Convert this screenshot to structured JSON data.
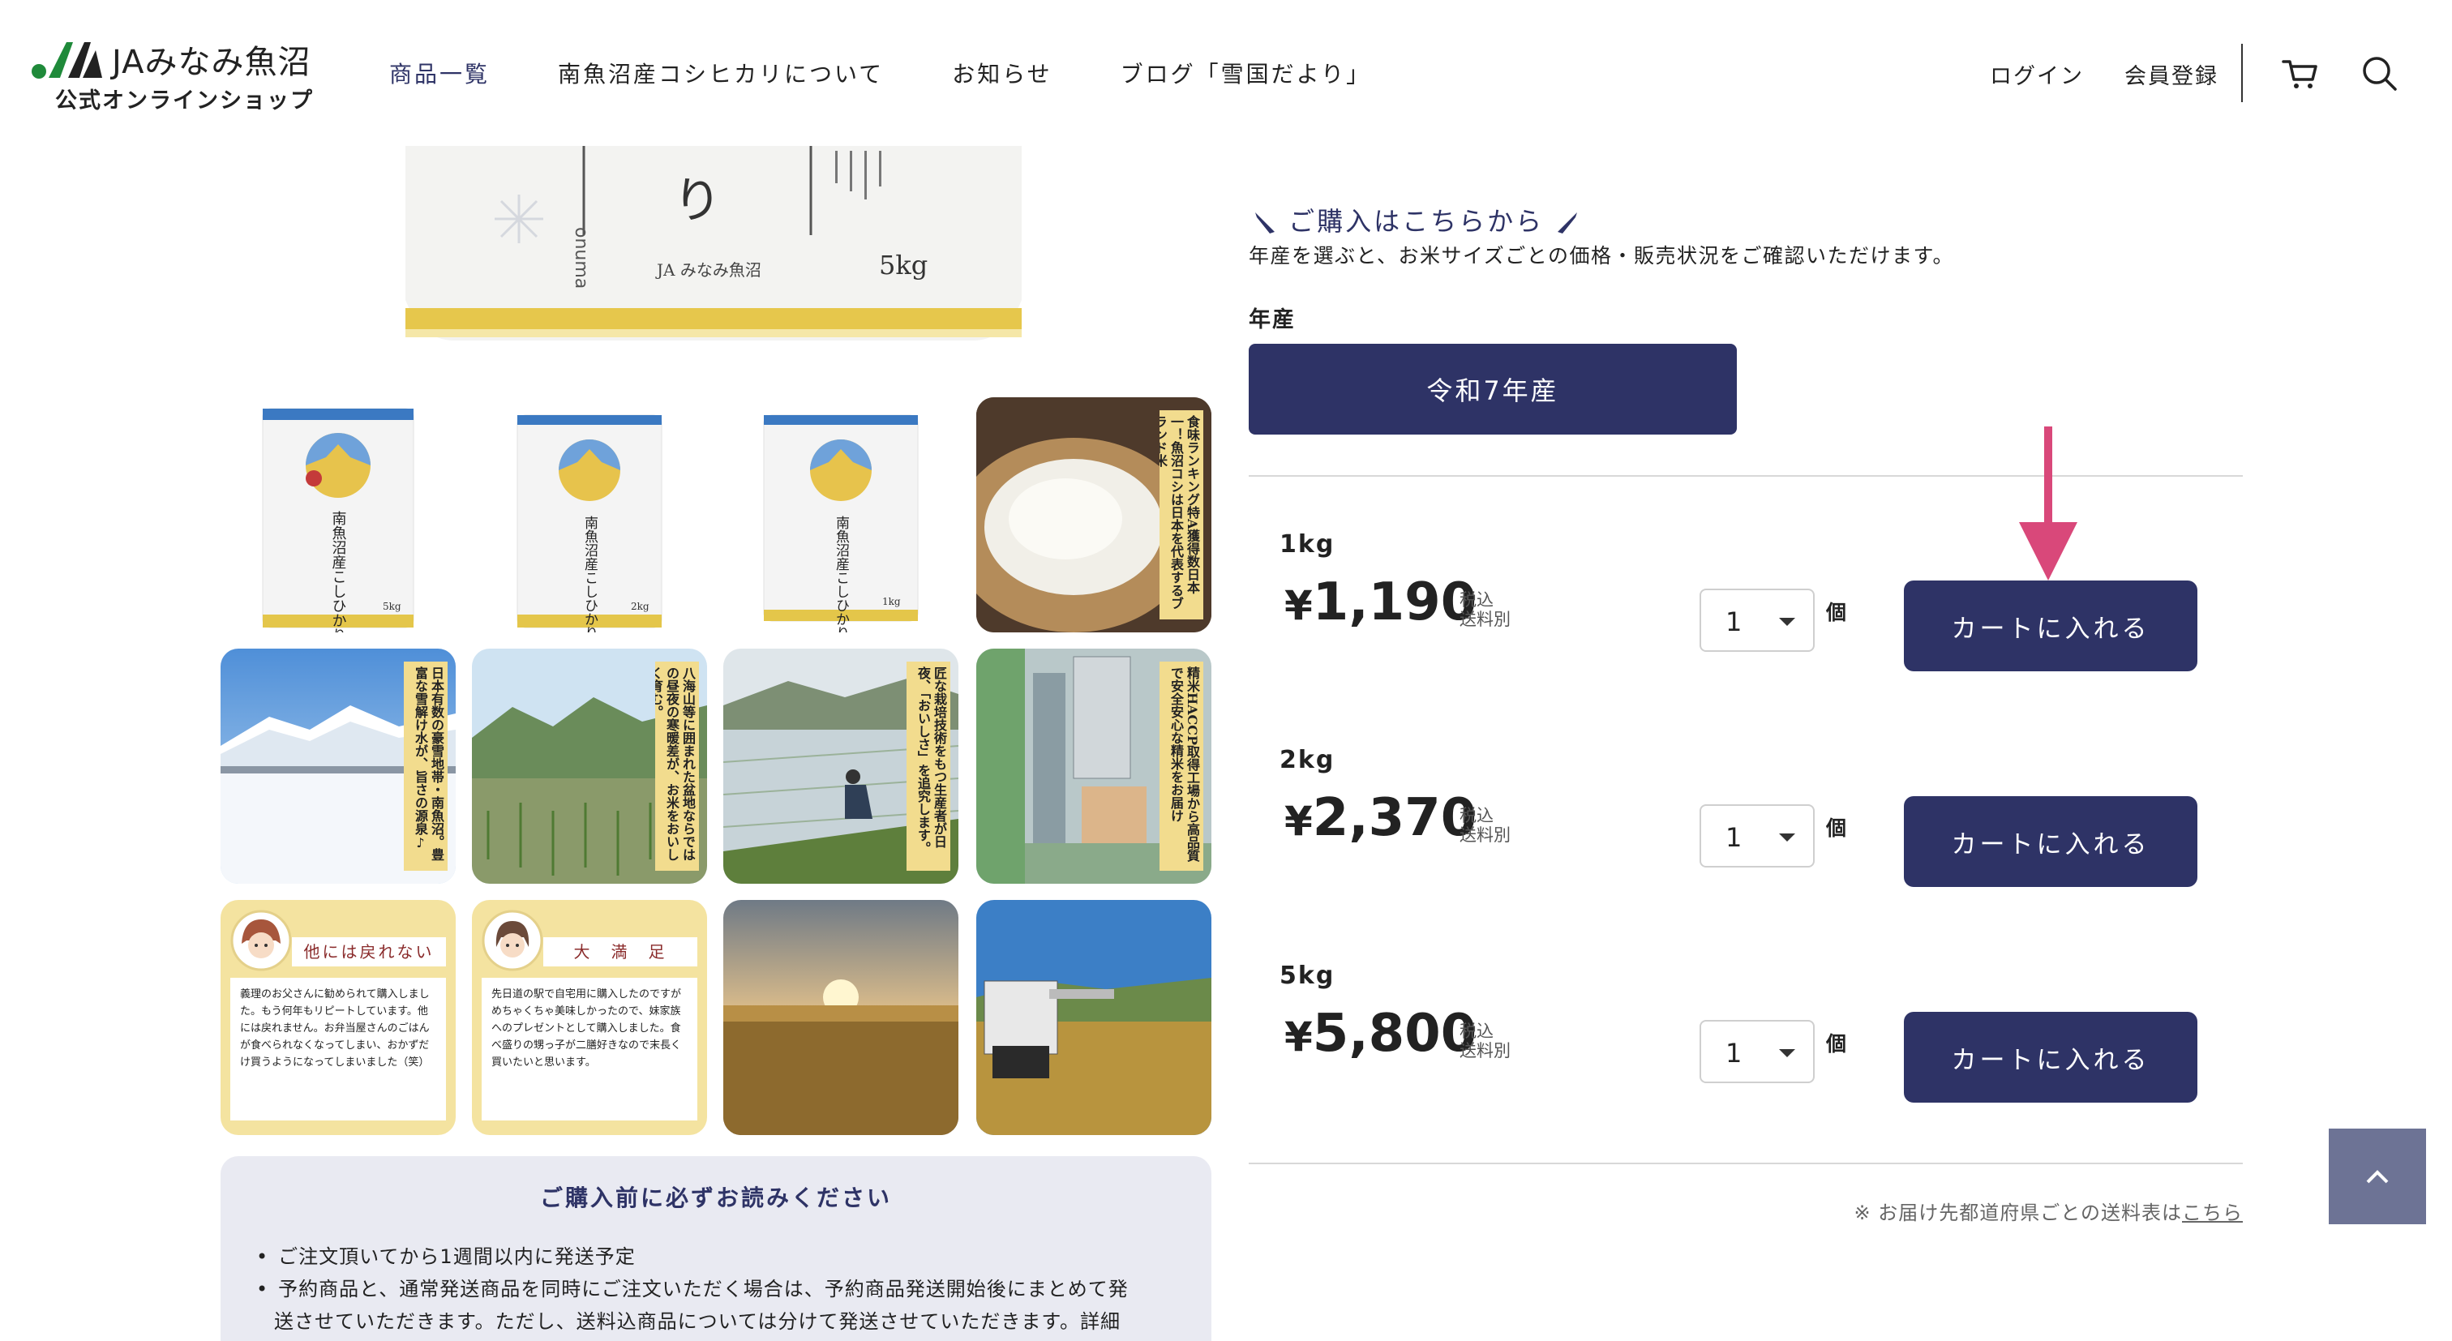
{
  "header": {
    "logo_text": "JAみなみ魚沼",
    "logo_sub": "公式オンラインショップ",
    "nav": [
      {
        "label": "商品一覧",
        "active": true
      },
      {
        "label": "南魚沼産コシヒカリについて",
        "active": false
      },
      {
        "label": "お知らせ",
        "active": false
      },
      {
        "label": "ブログ「雪国だより」",
        "active": false
      }
    ],
    "login": "ログイン",
    "register": "会員登録",
    "cart_icon": "cart-icon",
    "search_icon": "search-icon"
  },
  "hero": {
    "bag_brand": "JA みなみ魚沼",
    "bag_weight": "5kg",
    "bag_romaji": "onuma",
    "bag_kana": "り"
  },
  "gallery": {
    "bags": [
      {
        "title": "南魚沼産こしひかり",
        "weight": "5kg"
      },
      {
        "title": "南魚沼産こしひかり",
        "weight": "2kg"
      },
      {
        "title": "南魚沼産こしひかり",
        "weight": "1kg"
      }
    ],
    "captions": {
      "rice_bowl": "食味ランキング特A獲得数日本一！魚沼コシは日本を代表するブランド米",
      "snow": "日本有数の豪雪地帯・南魚沼。豊富な雪解け水が、旨さの源泉♪",
      "field": "八海山等に囲まれた盆地ならではの昼夜の寒暖差が、お米をおいしく育む。",
      "farmer": "匠な栽培技術をもつ生産者が日夜、「おいしさ」を追究します。",
      "factory": "精米HACCP取得工場から高品質で安全安心な精米をお届け"
    },
    "reviews": [
      {
        "title": "他には戻れない",
        "body": "義理のお父さんに勧められて購入しました。もう何年もリピートしています。他には戻れません。お弁当屋さんのごはんが食べられなくなってしまい、おかずだけ買うようになってしまいました（笑）"
      },
      {
        "title": "大　満　足",
        "body": "先日道の駅で自宅用に購入したのですがめちゃくちゃ美味しかったので、妹家族へのプレゼントとして購入しました。食べ盛りの甥っ子が二膳好きなので末長く買いたいと思います。"
      }
    ]
  },
  "notice": {
    "title": "ご購入前に必ずお読みください",
    "items": [
      "ご注文頂いてから1週間以内に発送予定",
      "予約商品と、通常発送商品を同時にご注文いただく場合は、予約商品発送開始後にまとめて発",
      "送させていただきます。ただし、送料込商品については分けて発送させていただきます。詳細"
    ]
  },
  "purchase": {
    "heading": "ご購入はこちらから",
    "description": "年産を選ぶと、お米サイズごとの価格・販売状況をご確認いただけます。",
    "year_label": "年産",
    "year_button": "令和7年産",
    "tax_line1": "税込",
    "tax_line2": "送料別",
    "unit": "個",
    "cart_label": "カートに入れる",
    "products": [
      {
        "size": "1kg",
        "price": "1,190",
        "qty": "1"
      },
      {
        "size": "2kg",
        "price": "2,370",
        "qty": "1"
      },
      {
        "size": "5kg",
        "price": "5,800",
        "qty": "1"
      }
    ],
    "currency": "¥",
    "ship_note": "※ お届け先都道府県ごとの送料表は",
    "ship_link": "こちら"
  },
  "colors": {
    "navy": "#2e3366",
    "arrow_pink": "#d9487a",
    "caption_gold": "#f2dc8e",
    "notice_bg": "#e9eaf2"
  }
}
